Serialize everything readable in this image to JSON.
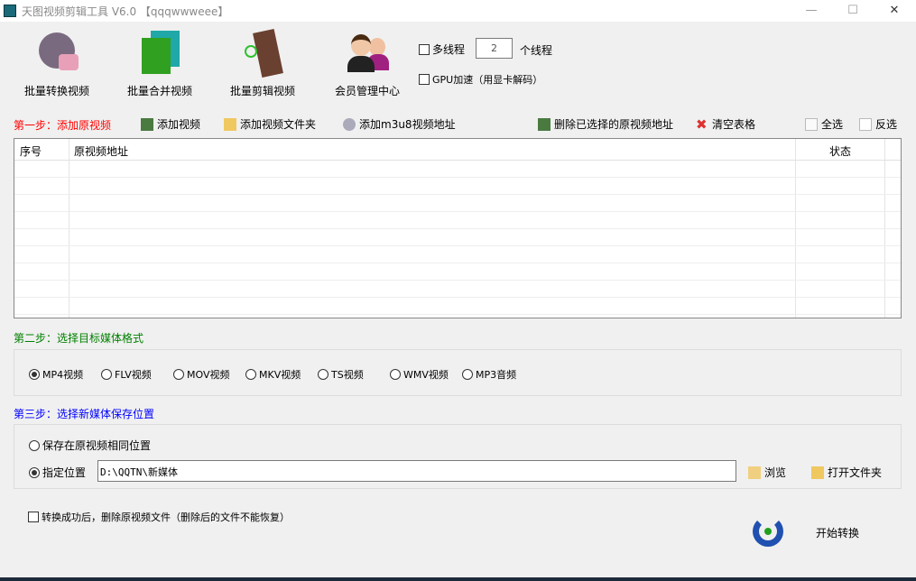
{
  "window": {
    "title": "天图视频剪辑工具 V6.0  【qqqwwweee】",
    "minimize": "—",
    "maximize": "☐",
    "close": "✕"
  },
  "toolbar": {
    "buttons": [
      {
        "label": "批量转换视频",
        "icon": "film-reel-convert-icon"
      },
      {
        "label": "批量合并视频",
        "icon": "merge-film-icon"
      },
      {
        "label": "批量剪辑视频",
        "icon": "film-cut-icon"
      },
      {
        "label": "会员管理中心",
        "icon": "users-icon"
      }
    ],
    "multithread_label": "多线程",
    "thread_count": "2",
    "thread_unit": "个线程",
    "gpu_label": "GPU加速（用显卡解码）"
  },
  "step1": {
    "label": "第一步：添加原视频",
    "add_video": "添加视频",
    "add_folder": "添加视频文件夹",
    "add_m3u8": "添加m3u8视频地址",
    "delete_selected": "删除已选择的原视频地址",
    "clear_table": "清空表格",
    "select_all": "全选",
    "invert_select": "反选",
    "columns": [
      "序号",
      "原视频地址",
      "状态"
    ]
  },
  "step2": {
    "label": "第二步：选择目标媒体格式",
    "formats": [
      "MP4视频",
      "FLV视频",
      "MOV视频",
      "MKV视频",
      "TS视频",
      "WMV视频",
      "MP3音频"
    ],
    "selected": "MP4视频"
  },
  "step3": {
    "label": "第三步：选择新媒体保存位置",
    "same_location": "保存在原视频相同位置",
    "specify_location": "指定位置",
    "path": "D:\\QQTN\\新媒体",
    "browse": "浏览",
    "open_folder": "打开文件夹"
  },
  "delete_after": "转换成功后，删除原视频文件（删除后的文件不能恢复）",
  "start": "开始转换",
  "colors": {
    "step1": "#ff0000",
    "step2": "#008000",
    "step3": "#0000ff"
  }
}
